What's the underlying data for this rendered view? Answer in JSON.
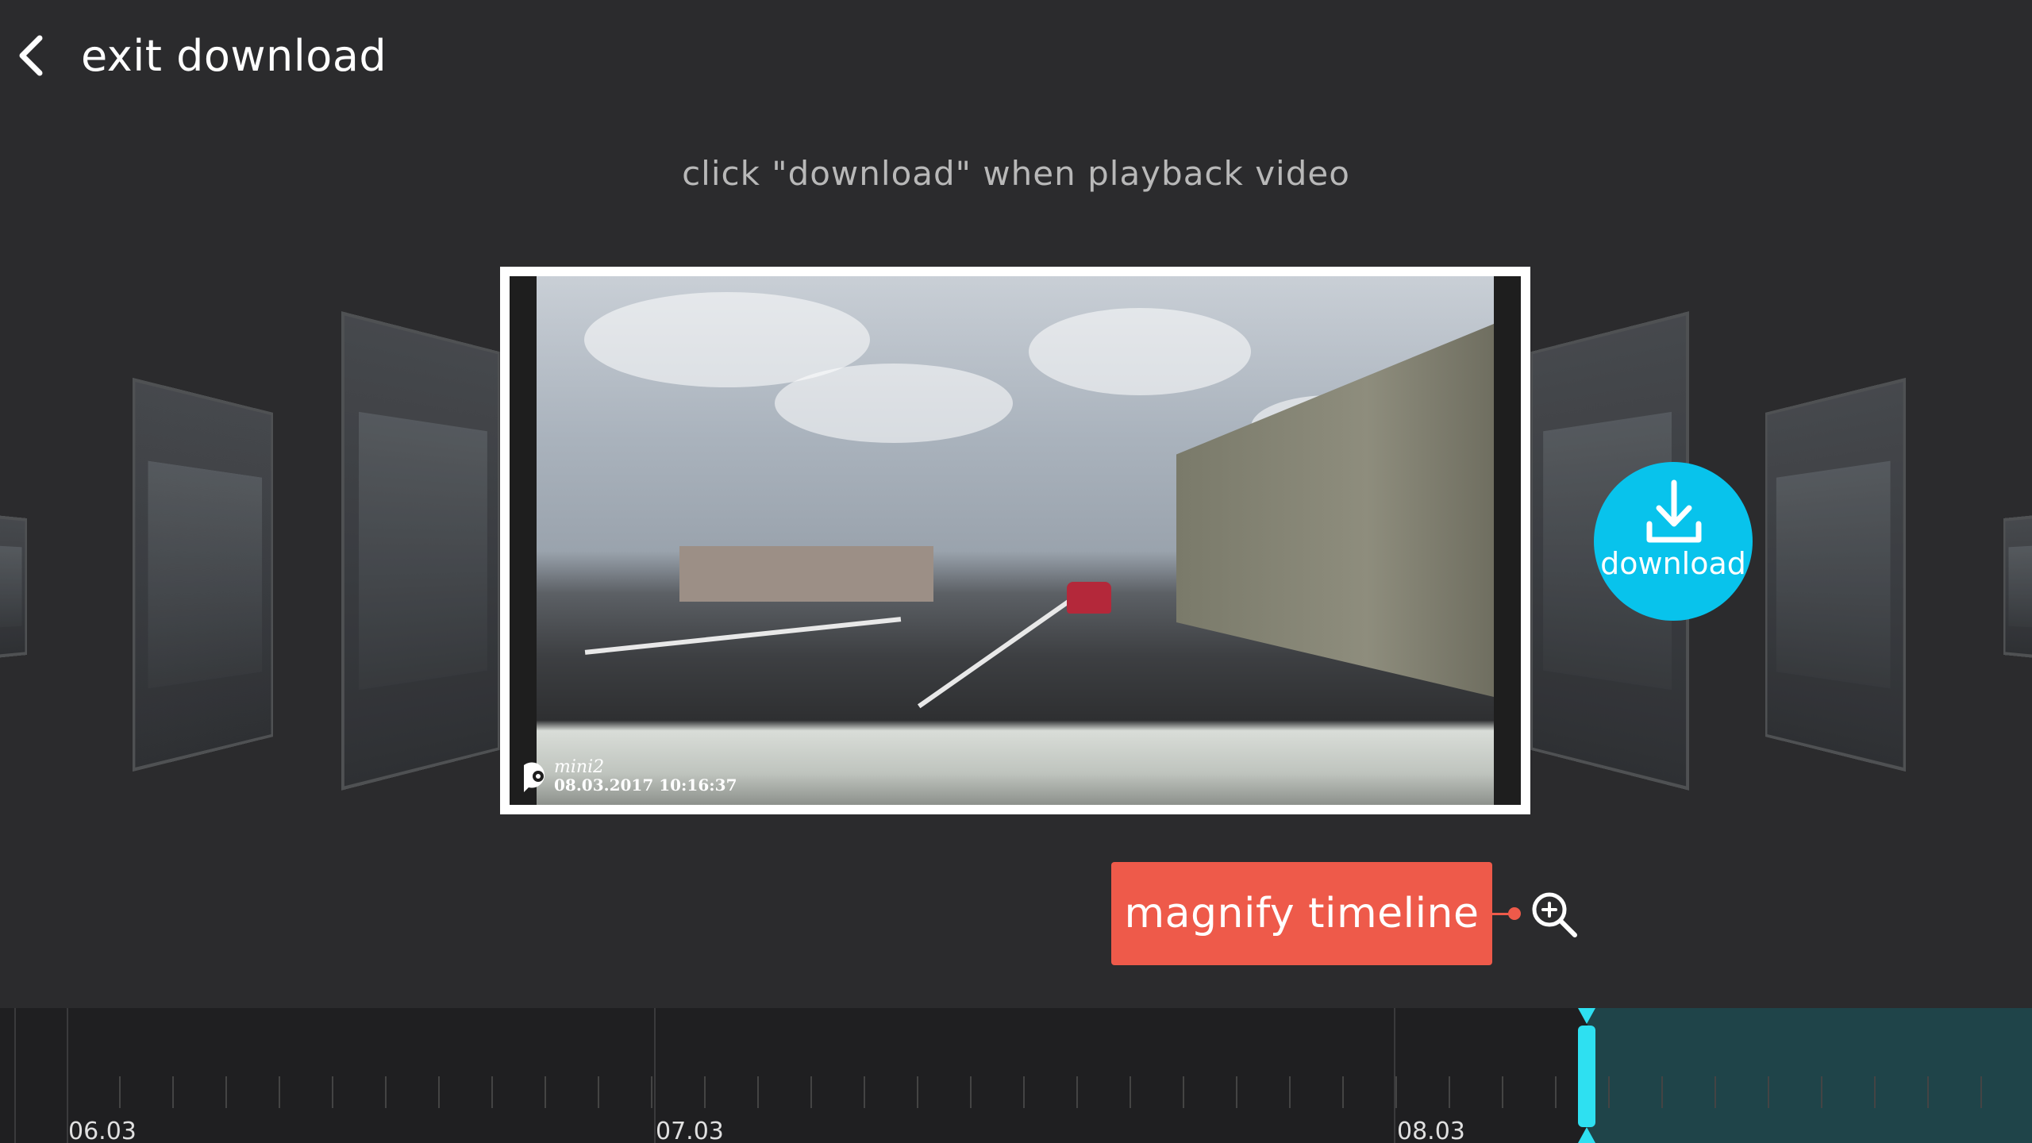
{
  "header": {
    "back_label": "exit download"
  },
  "hint": "click \"download\" when playback video",
  "video": {
    "brand": "mini2",
    "timestamp": "08.03.2017  10:16:37"
  },
  "download_button": {
    "label": "download"
  },
  "magnify": {
    "label": "magnify timeline"
  },
  "timeline": {
    "dates": [
      "06.03",
      "07.03",
      "08.03"
    ],
    "selection_color": "#1f4449",
    "playhead_color": "#2ee0f1"
  },
  "colors": {
    "accent": "#08c3ec",
    "callout": "#ee5a4a",
    "background": "#2b2b2d"
  }
}
